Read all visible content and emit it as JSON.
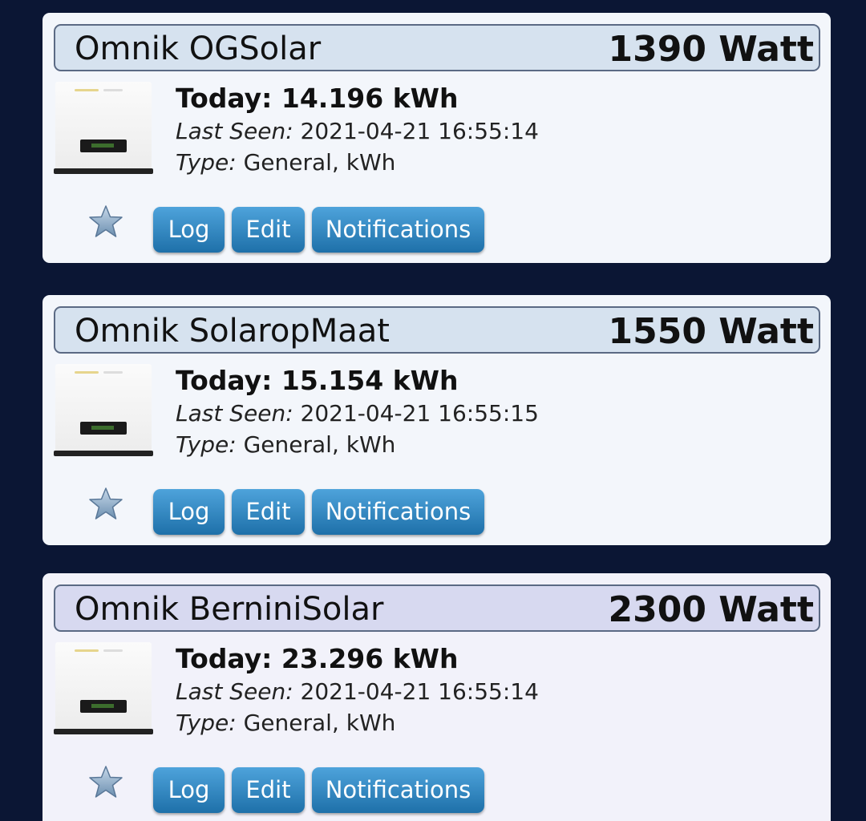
{
  "devices": [
    {
      "name": "Omnik OGSolar",
      "value": "1390 Watt",
      "today": "Today: 14.196 kWh",
      "last_seen_label": "Last Seen:",
      "last_seen_value": "2021-04-21 16:55:14",
      "type_label": "Type:",
      "type_value": "General, kWh"
    },
    {
      "name": "Omnik SolaropMaat",
      "value": "1550 Watt",
      "today": "Today: 15.154 kWh",
      "last_seen_label": "Last Seen:",
      "last_seen_value": "2021-04-21 16:55:15",
      "type_label": "Type:",
      "type_value": "General, kWh"
    },
    {
      "name": "Omnik BerniniSolar",
      "value": "2300 Watt",
      "today": "Today: 23.296 kWh",
      "last_seen_label": "Last Seen:",
      "last_seen_value": "2021-04-21 16:55:14",
      "type_label": "Type:",
      "type_value": "General, kWh"
    }
  ],
  "buttons": {
    "log": "Log",
    "edit": "Edit",
    "notifications": "Notifications"
  },
  "icons": {
    "favorite": "star-icon",
    "device": "inverter-image"
  },
  "colors": {
    "background": "#0b1634",
    "card": "#f3f6fb",
    "header": "#d6e2ef",
    "header_alt": "#d7d9f0",
    "button_top": "#4ea3db",
    "button_bottom": "#1e70a9"
  }
}
